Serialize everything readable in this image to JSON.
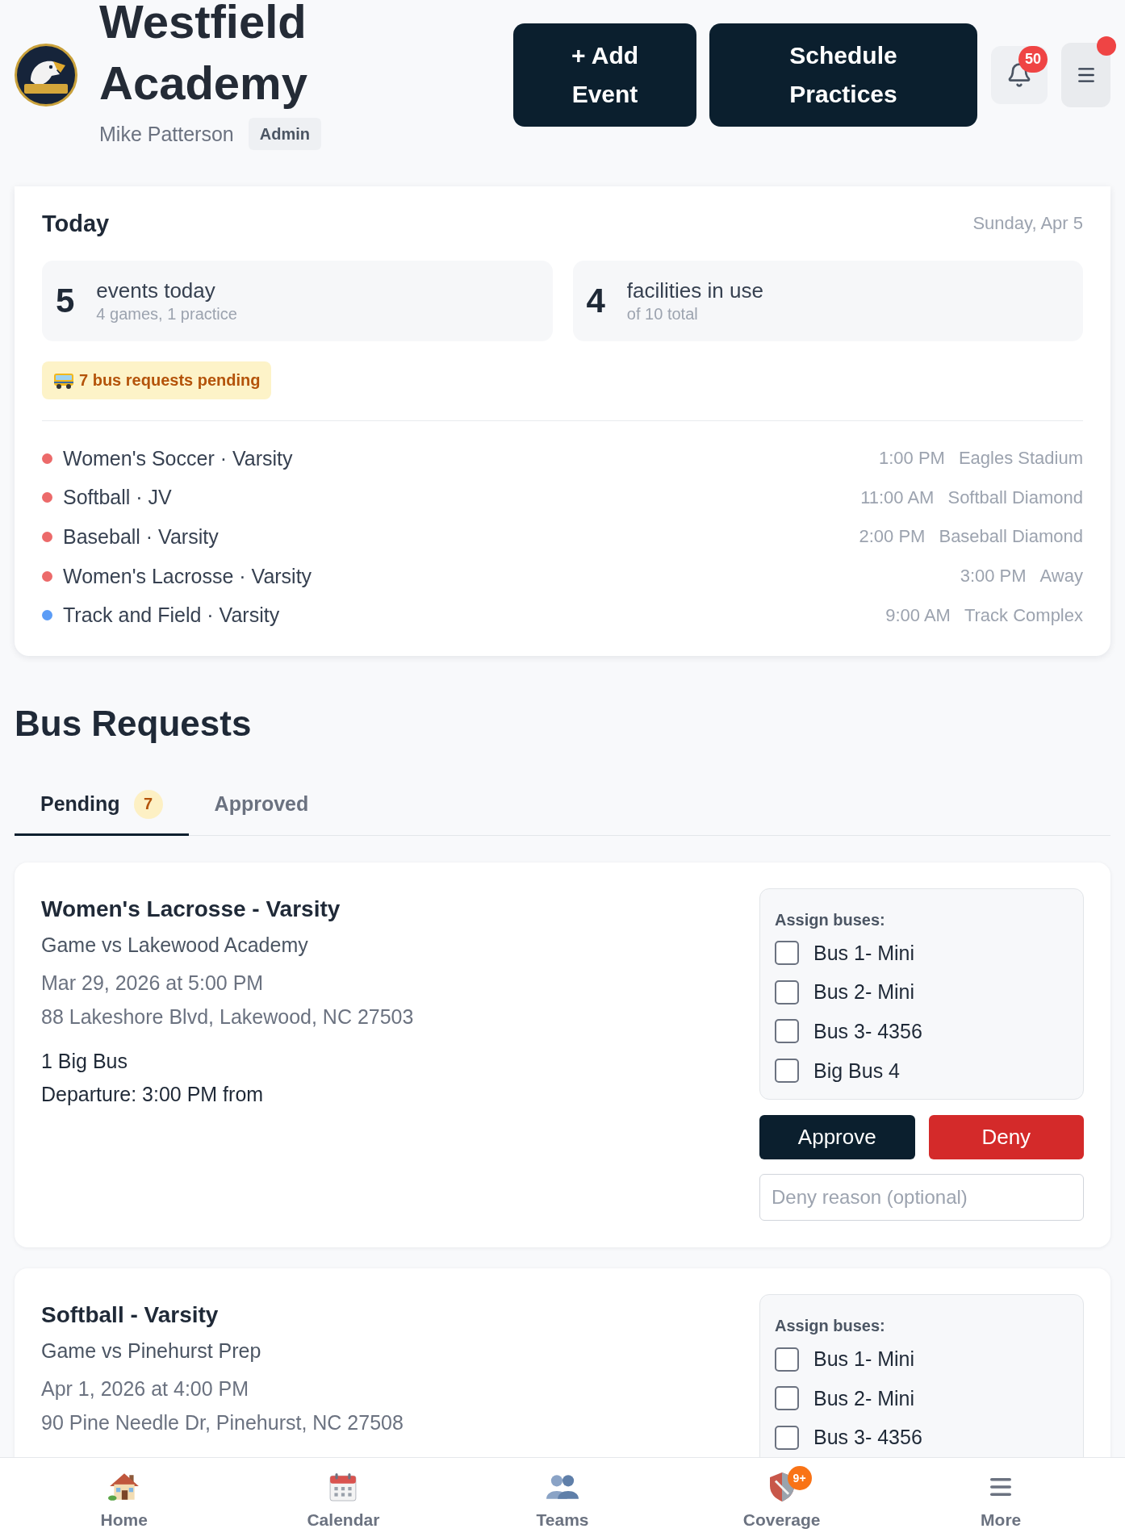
{
  "header": {
    "title": "Westfield Academy",
    "user_name": "Mike Patterson",
    "role": "Admin",
    "actions": [
      {
        "label": "+ Add Event"
      },
      {
        "label": "Schedule Practices"
      }
    ],
    "notification_count": "50",
    "menu_alert": true
  },
  "today": {
    "title": "Today",
    "date": "Sunday, Apr 5",
    "stats": [
      {
        "value": "5",
        "label": "events today",
        "detail": "4 games, 1 practice"
      },
      {
        "value": "4",
        "label": "facilities in use",
        "detail": "of 10 total"
      }
    ],
    "bus_alert": "7 bus requests pending",
    "events": [
      {
        "name": "Women's Soccer · Varsity",
        "time": "1:00 PM",
        "location": "Eagles Stadium",
        "color": "#ec6a6a"
      },
      {
        "name": "Softball · JV",
        "time": "11:00 AM",
        "location": "Softball Diamond",
        "color": "#ec6a6a"
      },
      {
        "name": "Baseball · Varsity",
        "time": "2:00 PM",
        "location": "Baseball Diamond",
        "color": "#ec6a6a"
      },
      {
        "name": "Women's Lacrosse · Varsity",
        "time": "3:00 PM",
        "location": "Away",
        "color": "#ec6a6a"
      },
      {
        "name": "Track and Field · Varsity",
        "time": "9:00 AM",
        "location": "Track Complex",
        "color": "#5b9cf6"
      }
    ]
  },
  "bus_requests": {
    "title": "Bus Requests",
    "tabs": [
      {
        "label": "Pending",
        "count": "7",
        "selected": true
      },
      {
        "label": "Approved",
        "selected": false
      }
    ],
    "requests": [
      {
        "team": "Women's Lacrosse - Varsity",
        "opponent": "Game vs Lakewood Academy",
        "datetime": "Mar 29, 2026 at 5:00 PM",
        "address": "88 Lakeshore Blvd, Lakewood, NC 27503",
        "bus_need": "1 Big Bus",
        "departure": "Departure: 3:00 PM from",
        "assign_label": "Assign buses:",
        "buses": [
          {
            "label": "Bus 1- Mini",
            "checked": false
          },
          {
            "label": "Bus 2- Mini",
            "checked": false
          },
          {
            "label": "Bus 3- 4356",
            "checked": false
          },
          {
            "label": "Big Bus 4",
            "checked": false
          }
        ],
        "actions": [
          {
            "label": "Approve",
            "kind": "approve"
          },
          {
            "label": "Deny",
            "kind": "deny"
          }
        ],
        "deny_reason": {
          "placeholder": "Deny reason (optional)"
        }
      },
      {
        "team": "Softball - Varsity",
        "opponent": "Game vs Pinehurst Prep",
        "datetime": "Apr 1, 2026 at 4:00 PM",
        "address": "90 Pine Needle Dr, Pinehurst, NC 27508",
        "assign_label": "Assign buses:",
        "buses": [
          {
            "label": "Bus 1- Mini",
            "checked": false
          },
          {
            "label": "Bus 2- Mini",
            "checked": false
          },
          {
            "label": "Bus 3- 4356",
            "checked": false
          }
        ]
      }
    ]
  },
  "bottom_nav": [
    {
      "label": "Home",
      "selected": false
    },
    {
      "label": "Calendar",
      "selected": false
    },
    {
      "label": "Teams",
      "selected": false
    },
    {
      "label": "Coverage",
      "badge": "9+",
      "selected": false
    },
    {
      "label": "More",
      "selected": false
    }
  ]
}
